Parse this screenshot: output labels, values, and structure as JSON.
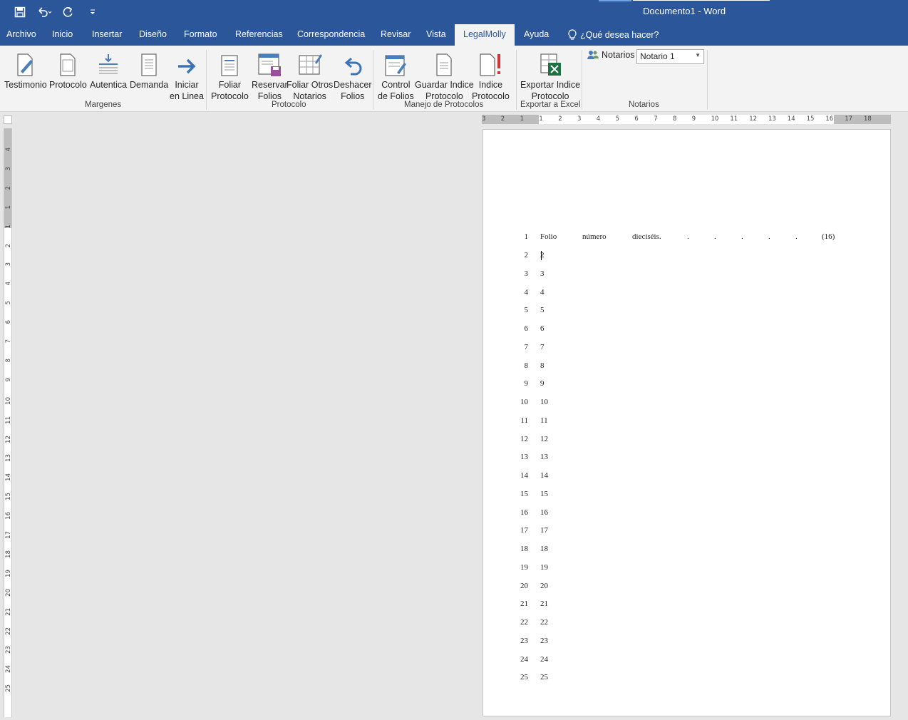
{
  "window": {
    "title": "Documento1  -  Word"
  },
  "qat": {
    "save_icon": "save-icon",
    "undo_icon": "undo-icon",
    "redo_icon": "redo-icon",
    "customize_icon": "customize-qat-icon"
  },
  "tabs": [
    {
      "label": "Archivo"
    },
    {
      "label": "Inicio"
    },
    {
      "label": "Insertar"
    },
    {
      "label": "Diseño"
    },
    {
      "label": "Formato"
    },
    {
      "label": "Referencias"
    },
    {
      "label": "Correspondencia"
    },
    {
      "label": "Revisar"
    },
    {
      "label": "Vista"
    },
    {
      "label": "LegalMolly"
    },
    {
      "label": "Ayuda"
    }
  ],
  "tell_me": "¿Qué desea hacer?",
  "ribbon": {
    "buttons": [
      {
        "l1": "Testimonio",
        "l2": ""
      },
      {
        "l1": "Protocolo",
        "l2": ""
      },
      {
        "l1": "Autentica",
        "l2": ""
      },
      {
        "l1": "Demanda",
        "l2": ""
      },
      {
        "l1": "Iniciar",
        "l2": "en Linea"
      },
      {
        "l1": "Foliar",
        "l2": "Protocolo"
      },
      {
        "l1": "Reservar",
        "l2": "Folios"
      },
      {
        "l1": "Foliar Otros",
        "l2": "Notarios"
      },
      {
        "l1": "Deshacer",
        "l2": "Folios"
      },
      {
        "l1": "Control",
        "l2": "de Folios"
      },
      {
        "l1": "Guardar Indice",
        "l2": "Protocolo"
      },
      {
        "l1": "Indice",
        "l2": "Protocolo"
      },
      {
        "l1": "Exportar Indice",
        "l2": "Protocolo"
      }
    ],
    "groups": [
      "Margenes",
      "Protocolo",
      "Manejo de Protocolos",
      "Exportar a Excel",
      "Notarios"
    ],
    "notarios_label": "Notarios",
    "notarios_value": "Notario 1"
  },
  "ruler": {
    "h": [
      "3",
      "2",
      "1",
      "1",
      "2",
      "3",
      "4",
      "5",
      "6",
      "7",
      "8",
      "9",
      "10",
      "11",
      "12",
      "13",
      "14",
      "15",
      "16",
      "17",
      "18"
    ],
    "v": [
      "4",
      "3",
      "2",
      "1",
      "1",
      "2",
      "3",
      "4",
      "5",
      "6",
      "7",
      "8",
      "9",
      "10",
      "11",
      "12",
      "13",
      "14",
      "15",
      "16",
      "17",
      "18",
      "19",
      "20",
      "21",
      "22",
      "23",
      "24",
      "25"
    ]
  },
  "document": {
    "first_line": {
      "num": "1",
      "words": [
        "Folio",
        "número",
        "dieciséis.",
        ".",
        ".",
        ".",
        ".",
        ".",
        "(16)"
      ]
    },
    "lines": [
      {
        "n": "2",
        "t": "2"
      },
      {
        "n": "3",
        "t": "3"
      },
      {
        "n": "4",
        "t": "4"
      },
      {
        "n": "5",
        "t": "5"
      },
      {
        "n": "6",
        "t": "6"
      },
      {
        "n": "7",
        "t": "7"
      },
      {
        "n": "8",
        "t": "8"
      },
      {
        "n": "9",
        "t": "9"
      },
      {
        "n": "10",
        "t": "10"
      },
      {
        "n": "11",
        "t": "11"
      },
      {
        "n": "12",
        "t": "12"
      },
      {
        "n": "13",
        "t": "13"
      },
      {
        "n": "14",
        "t": "14"
      },
      {
        "n": "15",
        "t": "15"
      },
      {
        "n": "16",
        "t": "16"
      },
      {
        "n": "17",
        "t": "17"
      },
      {
        "n": "18",
        "t": "18"
      },
      {
        "n": "19",
        "t": "19"
      },
      {
        "n": "20",
        "t": "20"
      },
      {
        "n": "21",
        "t": "21"
      },
      {
        "n": "22",
        "t": "22"
      },
      {
        "n": "23",
        "t": "23"
      },
      {
        "n": "24",
        "t": "24"
      },
      {
        "n": "25",
        "t": "25"
      }
    ]
  }
}
